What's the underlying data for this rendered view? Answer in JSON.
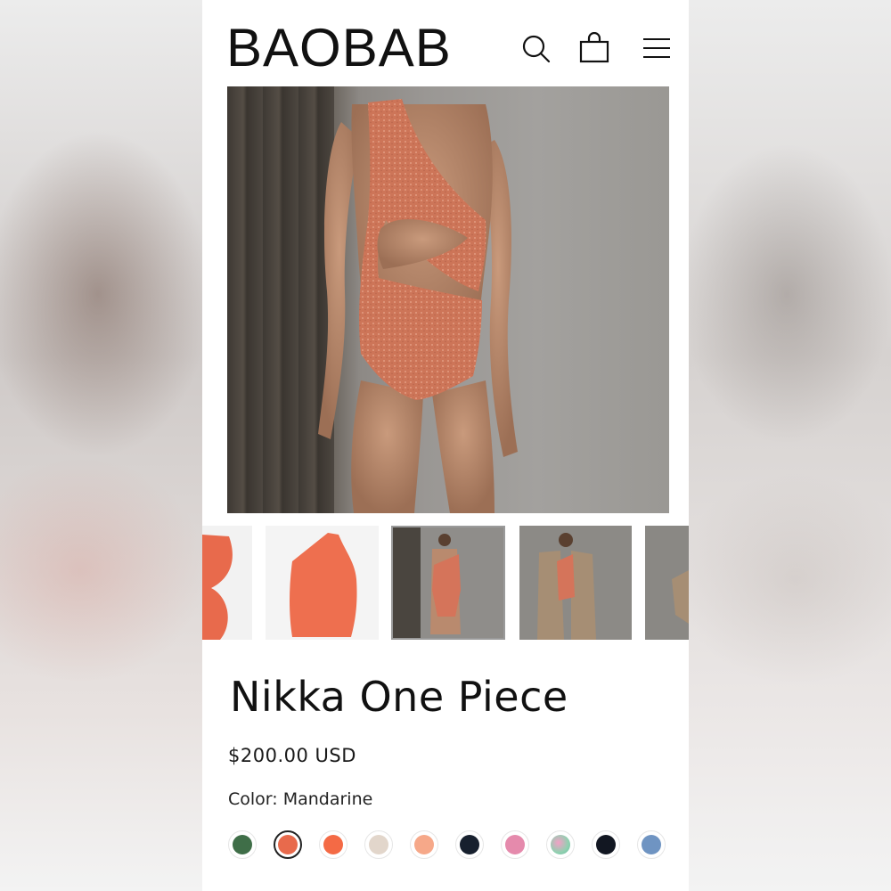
{
  "header": {
    "logo": "BAOBAB",
    "icons": [
      "search-icon",
      "shopping-bag-icon",
      "menu-icon"
    ]
  },
  "product": {
    "title": "Nikka One Piece",
    "price": "$200.00 USD",
    "color_label": "Color: Mandarine",
    "selected_swatch_index": 1
  },
  "gallery": {
    "thumbnail_count": 5,
    "selected_thumbnail_index": 2
  },
  "swatches": [
    {
      "color": "#3f6e48"
    },
    {
      "color": "#e86a4c"
    },
    {
      "color": "#f46a45"
    },
    {
      "color": "#e2d6cb"
    },
    {
      "color": "#f6a889"
    },
    {
      "color": "#17202e"
    },
    {
      "color": "#e58aac"
    },
    {
      "color": "#8fd1b0"
    },
    {
      "color": "#121722"
    },
    {
      "color": "#6f94c2"
    }
  ],
  "colors": {
    "swimsuit": "#d3765b",
    "text": "#111111"
  }
}
